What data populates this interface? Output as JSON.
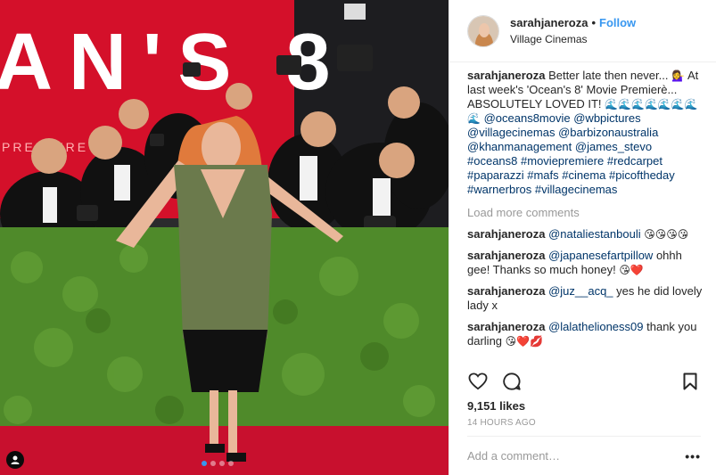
{
  "post": {
    "username": "sarahjaneroza",
    "separator": "•",
    "follow_label": "Follow",
    "location": "Village Cinemas",
    "backdrop_text": "AN'S 8",
    "backdrop_subtext": "PREMIERE"
  },
  "caption": {
    "user": "sarahjaneroza",
    "text1": "Better late then never...",
    "emoji1": "💁‍♀️",
    "text2": "At last week's 'Ocean's 8' Movie Premierè... ABSOLUTELY LOVED IT!",
    "emoji2": "🌊🌊🌊🌊🌊🌊🌊🌊",
    "tags": [
      "@oceans8movie",
      "@wbpictures",
      "@villagecinemas",
      "@barbizonaustralia",
      "@khanmanagement",
      "@james_stevo",
      "#oceans8",
      "#moviepremiere",
      "#redcarpet",
      "#paparazzi",
      "#mafs",
      "#cinema",
      "#picoftheday",
      "#warnerbros",
      "#villagecinemas"
    ]
  },
  "load_more": "Load more comments",
  "comments": [
    {
      "user": "sarahjaneroza",
      "mention": "@nataliestanbouli",
      "text": "",
      "emoji": "😘😘😘😘"
    },
    {
      "user": "sarahjaneroza",
      "mention": "@japanesefartpillow",
      "text": "ohhh gee! Thanks so much honey!",
      "emoji": "😘❤️"
    },
    {
      "user": "sarahjaneroza",
      "mention": "@juz__acq_",
      "text": "yes he did lovely lady x",
      "emoji": ""
    },
    {
      "user": "sarahjaneroza",
      "mention": "@lalathelioness09",
      "text": "thank you darling",
      "emoji": "😘❤️💋"
    }
  ],
  "actions": {
    "like_icon": "heart-icon",
    "comment_icon": "comment-icon",
    "save_icon": "bookmark-icon"
  },
  "likes": "9,151 likes",
  "timestamp": "14 HOURS AGO",
  "add_comment_placeholder": "Add a comment…",
  "more_options": "•••",
  "colors": {
    "link": "#3897f0",
    "mention": "#003569",
    "muted": "#999999",
    "carpet": "#c8102e",
    "hedge": "#4f8a2a"
  }
}
